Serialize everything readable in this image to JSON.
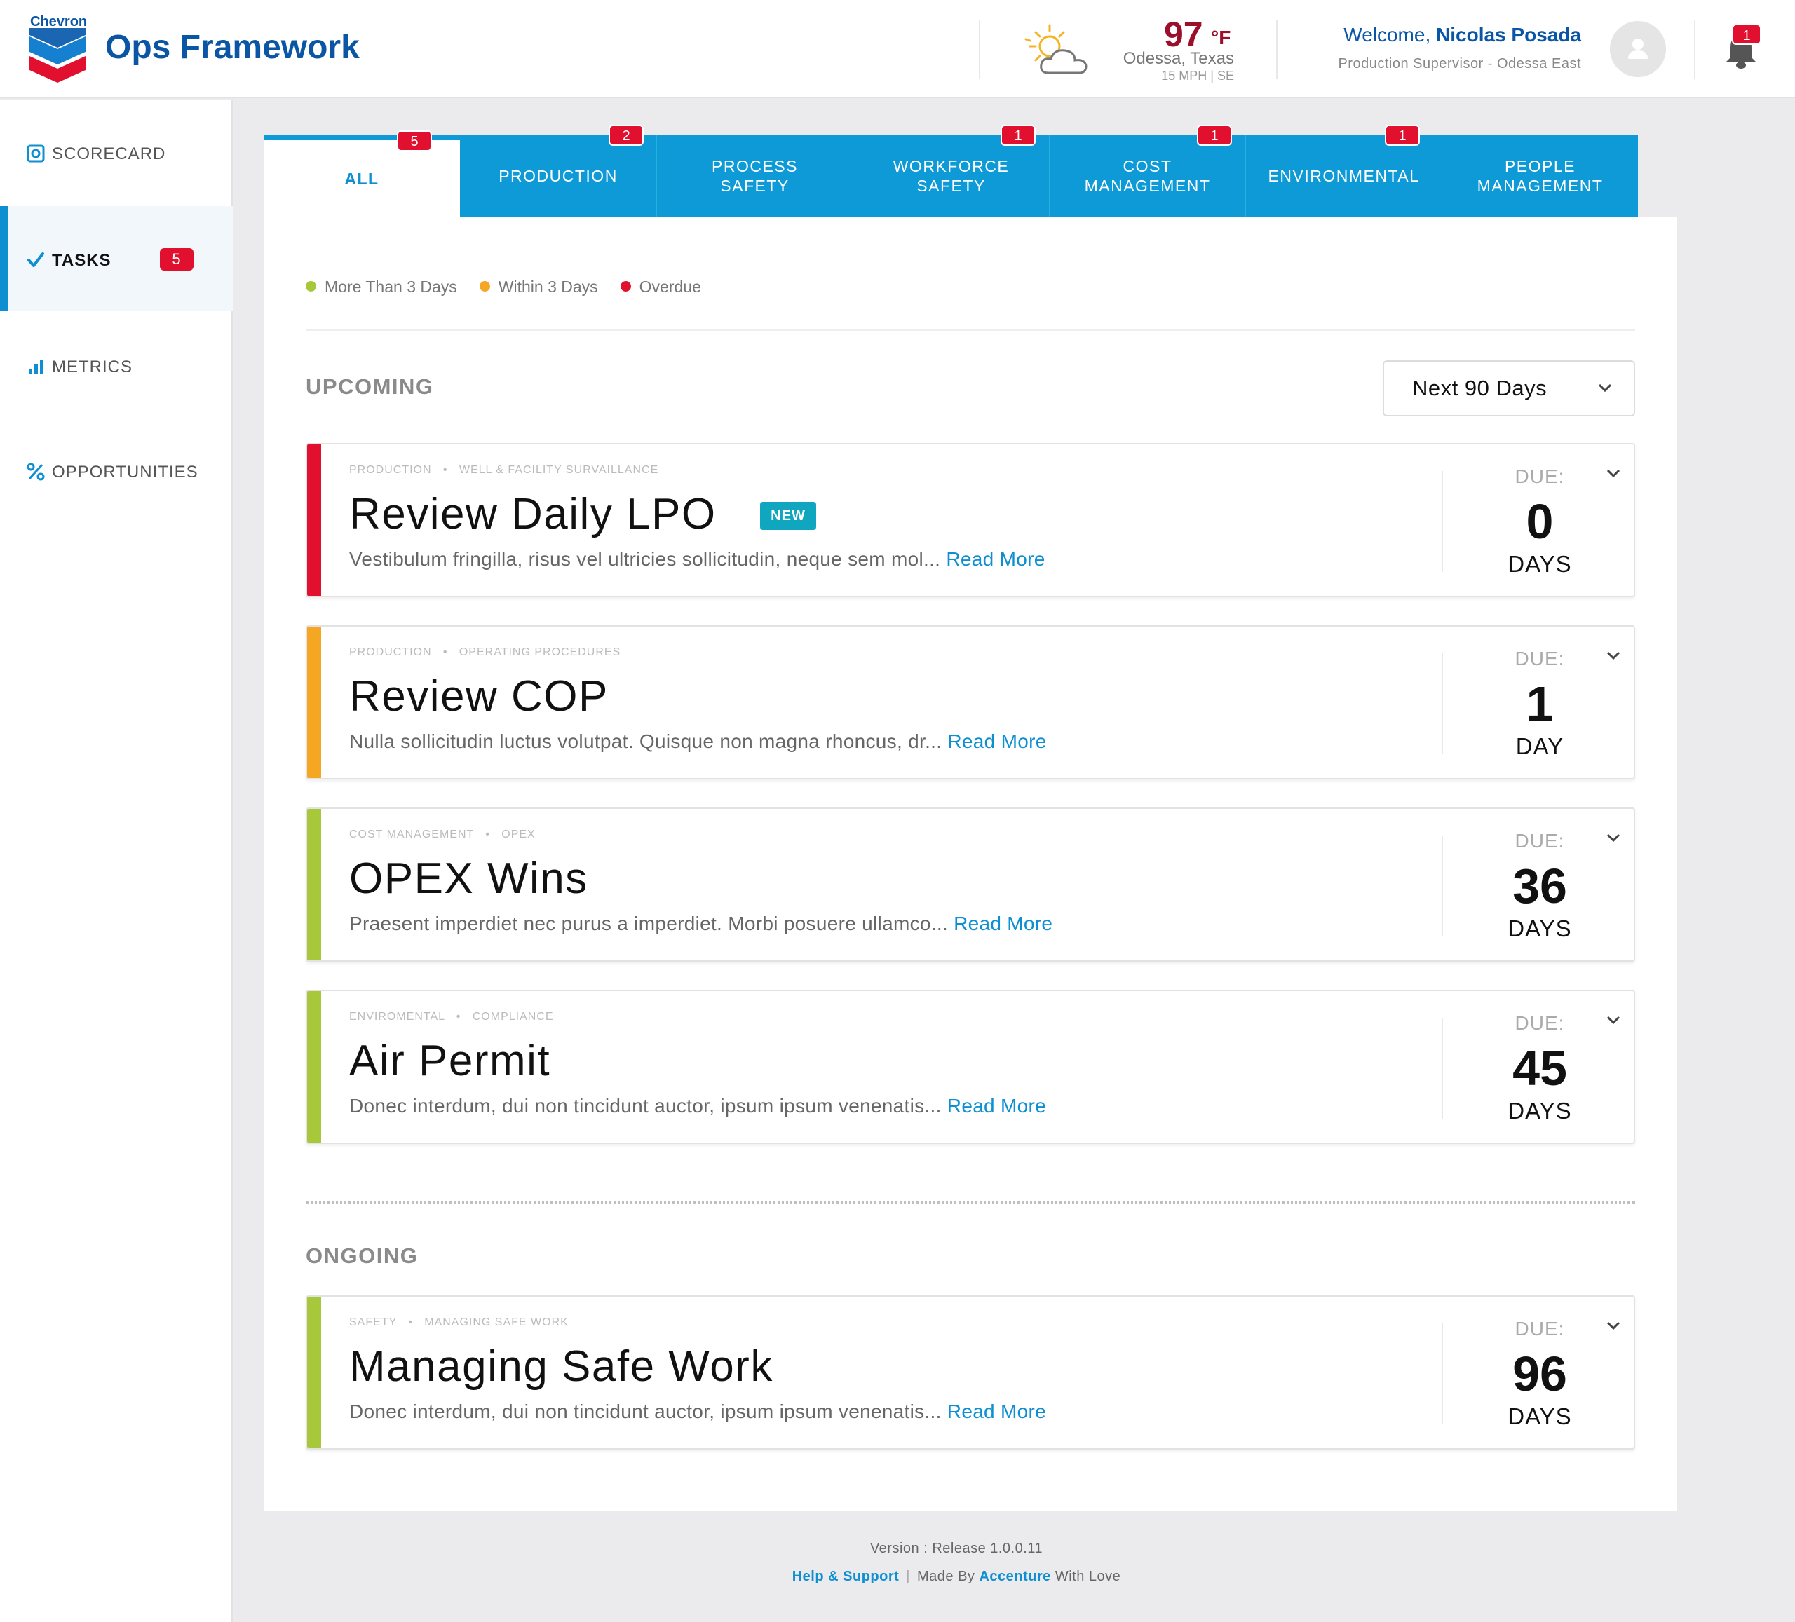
{
  "header": {
    "logo_text": "Chevron",
    "app_title": "Ops Framework",
    "weather": {
      "temperature": "97",
      "unit": "°F",
      "location": "Odessa, Texas",
      "wind": "15 MPH | SE",
      "icon": "partly-sunny-icon"
    },
    "welcome_prefix": "Welcome, ",
    "user_name": "Nicolas Posada",
    "user_role": "Production Supervisor - Odessa  East",
    "notification_count": "1",
    "colors": {
      "brand_blue": "#0a56a5",
      "temperature": "#9c0f2b"
    }
  },
  "sidebar": {
    "items": [
      {
        "label": "SCORECARD",
        "icon": "scorecard-icon"
      },
      {
        "label": "TASKS",
        "icon": "check-icon",
        "badge": "5",
        "active": true
      },
      {
        "label": "METRICS",
        "icon": "bar-chart-icon"
      },
      {
        "label": "OPPORTUNITIES",
        "icon": "percent-icon"
      }
    ],
    "active_color": "#0e8fd2"
  },
  "tabs": [
    {
      "label": "ALL",
      "badge": "5",
      "active": true
    },
    {
      "label": "PRODUCTION",
      "badge": "2"
    },
    {
      "label": "PROCESS SAFETY"
    },
    {
      "label": "WORKFORCE SAFETY",
      "badge": "1"
    },
    {
      "label": "COST MANAGEMENT",
      "badge": "1"
    },
    {
      "label": "ENVIRONMENTAL",
      "badge": "1"
    },
    {
      "label": "PEOPLE MANAGEMENT"
    }
  ],
  "legend": [
    {
      "label": "More Than 3 Days",
      "color": "#a7c83b"
    },
    {
      "label": "Within 3 Days",
      "color": "#f5a623"
    },
    {
      "label": "Overdue",
      "color": "#e0102e"
    }
  ],
  "upcoming": {
    "title": "UPCOMING",
    "filter": "Next 90 Days",
    "tasks": [
      {
        "category": "PRODUCTION",
        "subcategory": "WELL & FACILITY SURVAILLANCE",
        "title": "Review Daily LPO",
        "badge": "NEW",
        "description": "Vestibulum fringilla, risus vel ultricies sollicitudin, neque sem mol...",
        "read_more": "Read More",
        "due_label": "DUE:",
        "due_value": "0",
        "due_unit": "DAYS",
        "status_color": "#e0102e"
      },
      {
        "category": "PRODUCTION",
        "subcategory": "OPERATING PROCEDURES",
        "title": "Review COP",
        "description": "Nulla sollicitudin luctus volutpat. Quisque non magna rhoncus, dr...",
        "read_more": "Read More",
        "due_label": "DUE:",
        "due_value": "1",
        "due_unit": "DAY",
        "status_color": "#f5a623"
      },
      {
        "category": "COST MANAGEMENT",
        "subcategory": "OPEX",
        "title": "OPEX Wins",
        "description": "Praesent imperdiet nec purus a imperdiet. Morbi posuere ullamco...",
        "read_more": "Read More",
        "due_label": "DUE:",
        "due_value": "36",
        "due_unit": "DAYS",
        "status_color": "#a7c83b"
      },
      {
        "category": "ENVIROMENTAL",
        "subcategory": "COMPLIANCE",
        "title": "Air Permit",
        "description": "Donec interdum, dui non tincidunt auctor, ipsum ipsum venenatis...",
        "read_more": "Read More",
        "due_label": "DUE:",
        "due_value": "45",
        "due_unit": "DAYS",
        "status_color": "#a7c83b"
      }
    ]
  },
  "ongoing": {
    "title": "ONGOING",
    "tasks": [
      {
        "category": "SAFETY",
        "subcategory": "MANAGING SAFE WORK",
        "title": "Managing Safe Work",
        "description": "Donec interdum, dui non tincidunt auctor, ipsum ipsum venenatis...",
        "read_more": "Read More",
        "due_label": "DUE:",
        "due_value": "96",
        "due_unit": "DAYS",
        "status_color": "#a7c83b"
      }
    ]
  },
  "footer": {
    "version": "Version : Release 1.0.0.11",
    "help_link": "Help & Support",
    "made_by_prefix": "Made By ",
    "made_by_company": "Accenture",
    "made_by_suffix": " With Love"
  }
}
